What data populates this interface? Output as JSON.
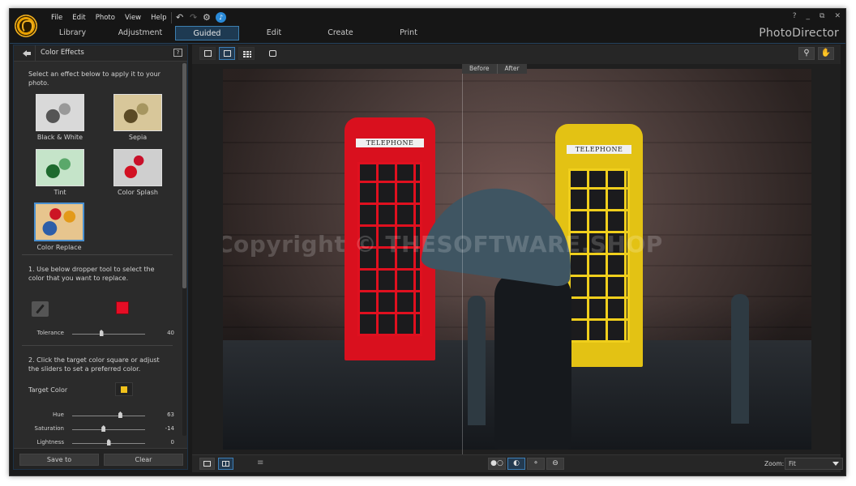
{
  "app": {
    "brand": "PhotoDirector",
    "menu": [
      "File",
      "Edit",
      "Photo",
      "View",
      "Help"
    ],
    "toolbar_icons": [
      "undo-icon",
      "redo-icon",
      "settings-icon",
      "notification-icon"
    ],
    "window_controls": {
      "help": "?",
      "minimize": "_",
      "restore": "⧉",
      "close": "✕"
    }
  },
  "modes": [
    {
      "label": "Library",
      "active": false
    },
    {
      "label": "Adjustment",
      "active": false
    },
    {
      "label": "Guided",
      "active": true
    },
    {
      "label": "Edit",
      "active": false
    },
    {
      "label": "Create",
      "active": false
    },
    {
      "label": "Print",
      "active": false
    }
  ],
  "panel": {
    "title": "Color Effects",
    "help_icon": "?",
    "intro": "Select an effect below to apply it to your photo.",
    "effects": [
      {
        "label": "Black & White",
        "selected": false
      },
      {
        "label": "Sepia",
        "selected": false
      },
      {
        "label": "Tint",
        "selected": false
      },
      {
        "label": "Color Splash",
        "selected": false
      },
      {
        "label": "Color Replace",
        "selected": true
      }
    ],
    "step1": "1. Use below dropper tool to select the color that you want to replace.",
    "source_color": "#e60d25",
    "tolerance": {
      "label": "Tolerance",
      "value": "40",
      "fraction": 0.4
    },
    "step2": "2. Click the target color square or adjust the sliders to set a preferred color.",
    "target_label": "Target Color",
    "target_color": "#f1c21b",
    "sliders": [
      {
        "label": "Hue",
        "value": "63",
        "fraction": 0.66
      },
      {
        "label": "Saturation",
        "value": "-14",
        "fraction": 0.43
      },
      {
        "label": "Lightness",
        "value": "0",
        "fraction": 0.5
      }
    ],
    "save_label": "Save to",
    "clear_label": "Clear"
  },
  "viewer": {
    "before_label": "Before",
    "after_label": "After",
    "watermark": "Copyright © THESOFTWARE.SHOP",
    "booth_sign": "TELEPHONE",
    "zoom_label": "Zoom:",
    "zoom_value": "Fit"
  },
  "colors": {
    "accent": "#3c7fb0",
    "active_bg": "#1e3a52"
  }
}
